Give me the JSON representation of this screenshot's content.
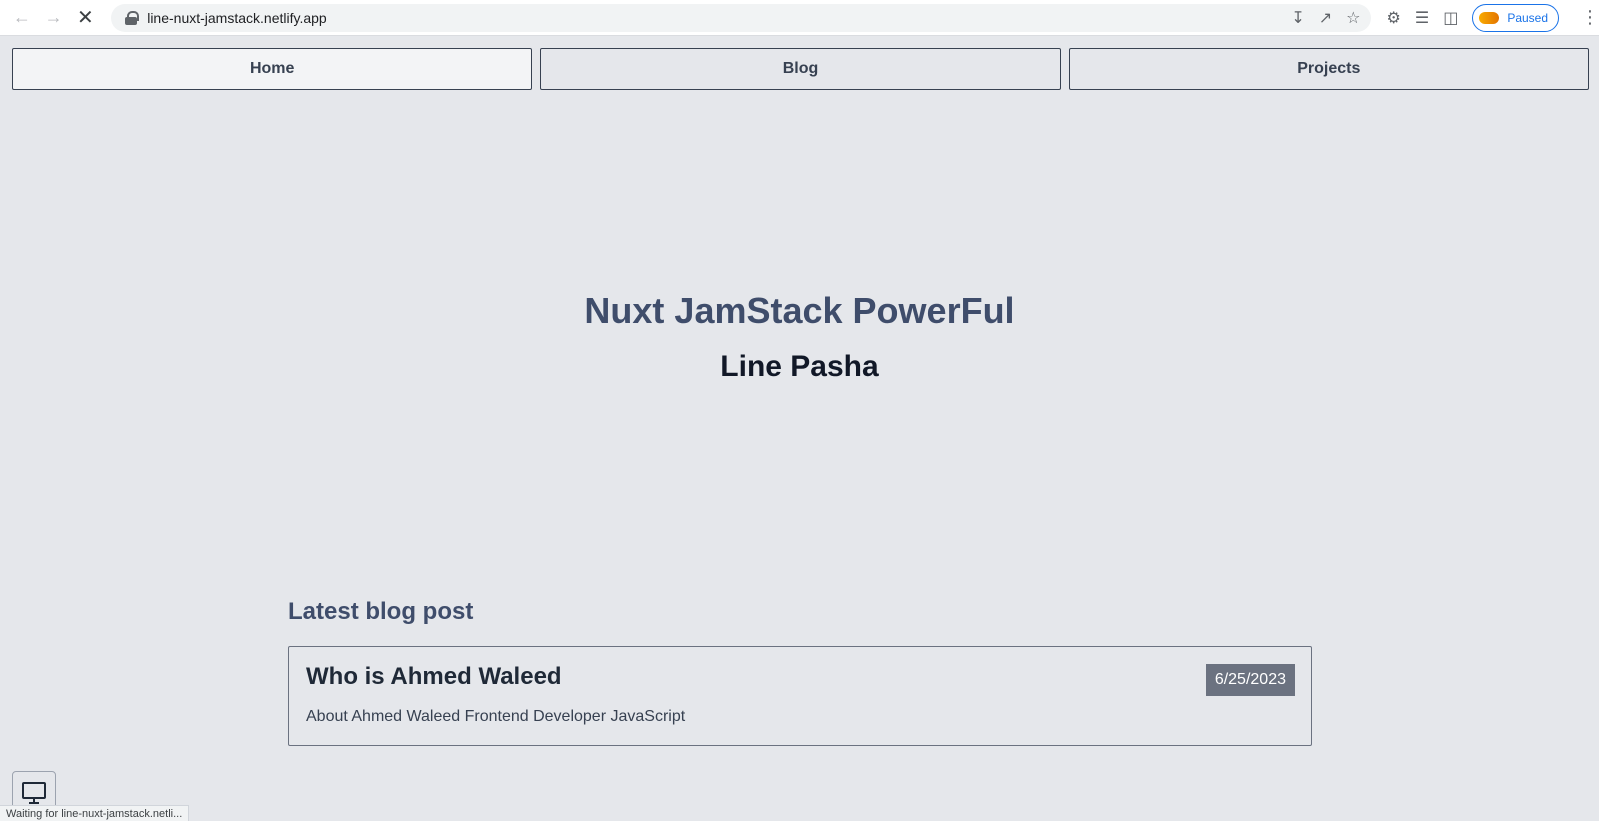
{
  "browser": {
    "url": "line-nuxt-jamstack.netlify.app",
    "profile_status": "Paused"
  },
  "nav": {
    "items": [
      {
        "label": "Home"
      },
      {
        "label": "Blog"
      },
      {
        "label": "Projects"
      }
    ]
  },
  "hero": {
    "title": "Nuxt JamStack PowerFul",
    "subtitle": "Line Pasha"
  },
  "latest": {
    "heading": "Latest blog post",
    "post": {
      "title": "Who is Ahmed Waleed",
      "date": "6/25/2023",
      "description": "About Ahmed Waleed Frontend Developer JavaScript"
    }
  },
  "status_bar": {
    "text": "Waiting for line-nuxt-jamstack.netli..."
  }
}
